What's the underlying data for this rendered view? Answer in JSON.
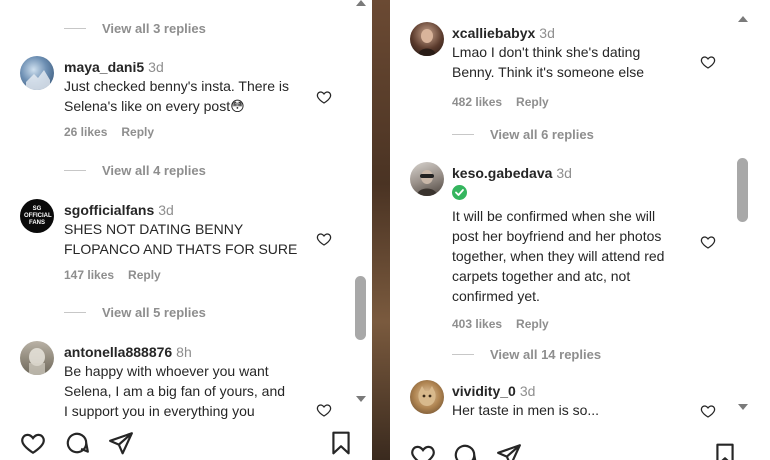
{
  "left": {
    "view_replies_top": "View all 3 replies",
    "comments": [
      {
        "username": "maya_dani5",
        "time": "3d",
        "text": "Just checked benny's insta. There is\nSelena's like on every post😳",
        "likes": "26 likes",
        "reply": "Reply",
        "view_replies": "View all 4 replies"
      },
      {
        "username": "sgofficialfans",
        "time": "3d",
        "text": "SHES NOT DATING BENNY\nFLOPANCO AND THATS FOR SURE",
        "likes": "147 likes",
        "reply": "Reply",
        "view_replies": "View all 5 replies",
        "avatar_text": "SG OFFICIAL FANS"
      },
      {
        "username": "antonella888876",
        "time": "8h",
        "text": "Be happy with whoever you want\nSelena, I am a big fan of yours, and\nI support you in everything you"
      }
    ]
  },
  "right": {
    "comments": [
      {
        "username": "xcalliebabyx",
        "time": "3d",
        "text": "Lmao I don't think she's dating\nBenny. Think it's someone else",
        "likes": "482 likes",
        "reply": "Reply",
        "view_replies": "View all 6 replies"
      },
      {
        "username": "keso.gabedava",
        "time": "3d",
        "text": "It will be confirmed when she will\npost her boyfriend and her photos\ntogether, when they will attend red\ncarpets together and atc, not\nconfirmed yet.",
        "likes": "403 likes",
        "reply": "Reply",
        "view_replies": "View all 14 replies"
      },
      {
        "username": "vividity_0",
        "time": "3d",
        "text": "Her taste in men is so..."
      }
    ]
  },
  "colors": {
    "text": "#262626",
    "muted": "#8e8e8e",
    "verified": "#35b55e",
    "scroll_thumb": "#a8a8a8"
  },
  "icons": {
    "like": "heart-icon",
    "comment": "comment-icon",
    "share": "share-icon",
    "save": "bookmark-icon",
    "verified": "verified-badge-icon"
  },
  "scrollbars": {
    "left_position": 0.73,
    "right_position": 0.47
  }
}
